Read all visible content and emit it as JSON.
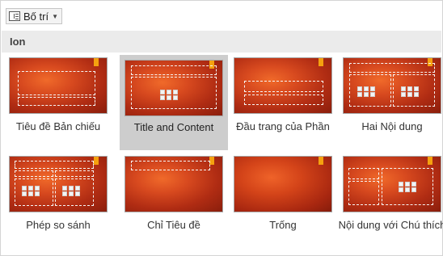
{
  "toolbar": {
    "layout_button_label": "Bố trí"
  },
  "group": {
    "title": "Ion"
  },
  "layouts": [
    {
      "label": "Tiêu đề Bản chiếu"
    },
    {
      "label": "Title and Content"
    },
    {
      "label": "Đầu trang của Phần"
    },
    {
      "label": "Hai Nội dung"
    },
    {
      "label": "Phép so sánh"
    },
    {
      "label": "Chỉ Tiêu đề"
    },
    {
      "label": "Trống"
    },
    {
      "label": "Nội dung với Chú thích"
    }
  ],
  "selected_layout": "Title and Content",
  "colors": {
    "theme_orange": "#d84a1f",
    "accent_tab": "#f5a10f",
    "selection": "#cdcdcd"
  }
}
